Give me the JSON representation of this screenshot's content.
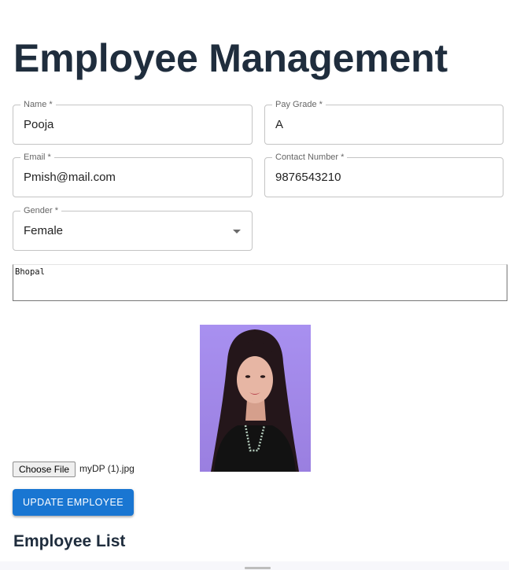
{
  "page": {
    "title": "Employee Management"
  },
  "form": {
    "name": {
      "label": "Name *",
      "value": "Pooja"
    },
    "pay_grade": {
      "label": "Pay Grade *",
      "value": "A"
    },
    "email": {
      "label": "Email *",
      "value": "Pmish@mail.com"
    },
    "contact": {
      "label": "Contact Number *",
      "value": "9876543210"
    },
    "gender": {
      "label": "Gender *",
      "value": "Female"
    },
    "address": {
      "value": "Bhopal"
    },
    "photo": {
      "icon": "employee-photo"
    },
    "file": {
      "button_label": "Choose File",
      "file_name": "myDP (1).jpg"
    },
    "submit_label": "UPDATE EMPLOYEE"
  },
  "list": {
    "title": "Employee List"
  },
  "colors": {
    "heading": "#1f2d3d",
    "primary": "#1976d2",
    "field_border": "#c4c4c4",
    "photo_background": "#a98ee8"
  }
}
